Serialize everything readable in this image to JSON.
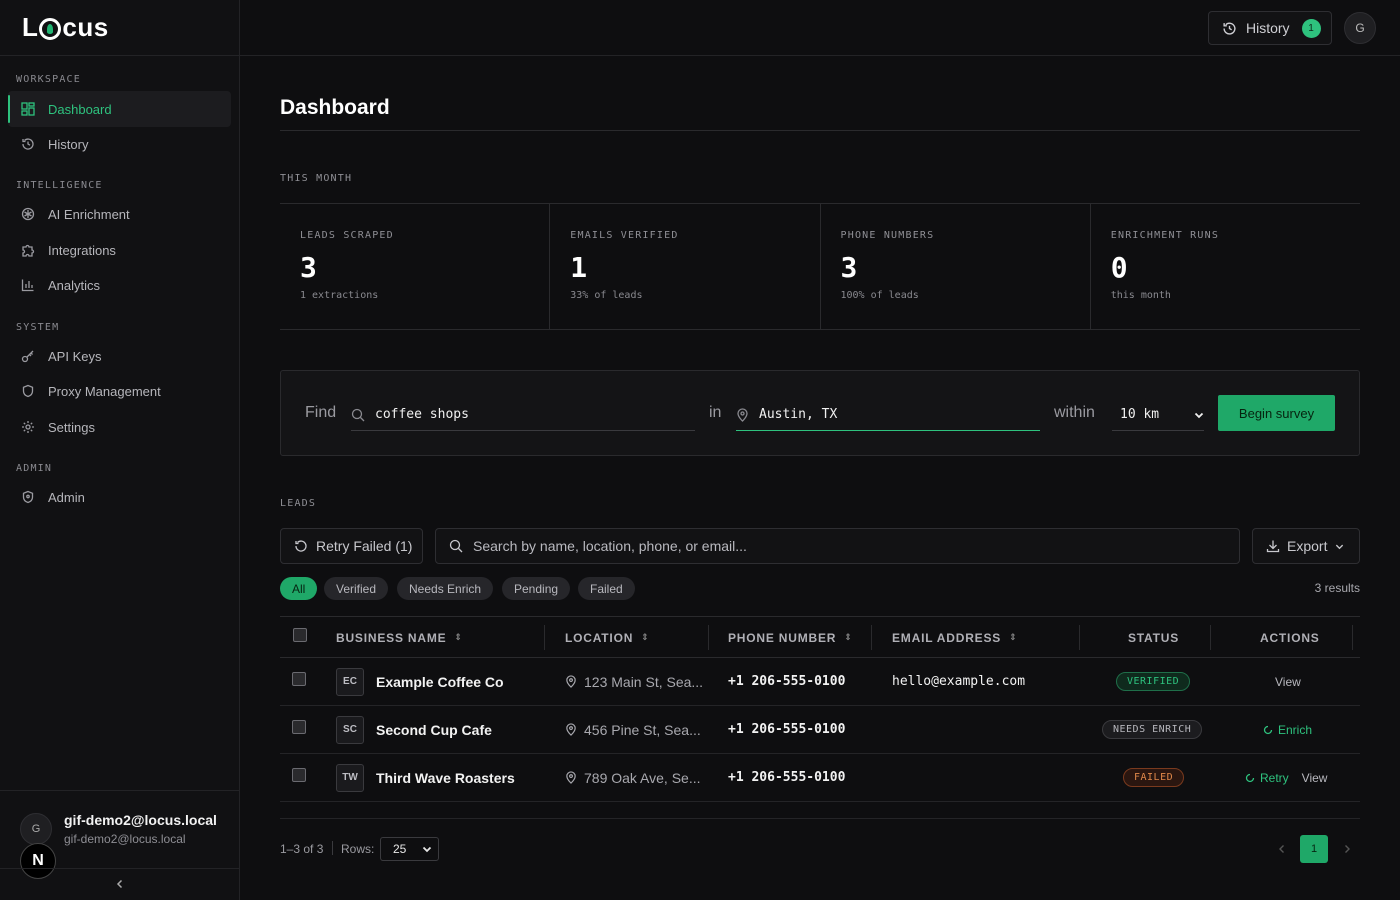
{
  "brand": {
    "logo_left": "L",
    "logo_right": "cus"
  },
  "sidebar": {
    "sections": [
      {
        "label": "WORKSPACE"
      },
      {
        "label": "INTELLIGENCE"
      },
      {
        "label": "SYSTEM"
      },
      {
        "label": "ADMIN"
      }
    ],
    "items": [
      {
        "label": "Dashboard",
        "icon": "grid-icon"
      },
      {
        "label": "History",
        "icon": "history-icon"
      },
      {
        "label": "AI Enrichment",
        "icon": "ai-icon"
      },
      {
        "label": "Integrations",
        "icon": "puzzle-icon"
      },
      {
        "label": "Analytics",
        "icon": "bar-chart-icon"
      },
      {
        "label": "API Keys",
        "icon": "key-icon"
      },
      {
        "label": "Proxy Management",
        "icon": "shield-icon"
      },
      {
        "label": "Settings",
        "icon": "gear-icon"
      },
      {
        "label": "Admin",
        "icon": "shield-check-icon"
      }
    ],
    "user": {
      "initial": "G",
      "name": "gif-demo2@locus.local",
      "email": "gif-demo2@locus.local"
    },
    "next_badge": "N"
  },
  "topbar": {
    "history_label": "History",
    "history_count": "1",
    "avatar_initial": "G"
  },
  "page": {
    "title": "Dashboard",
    "period_label": "THIS MONTH"
  },
  "stats": [
    {
      "label": "LEADS SCRAPED",
      "value": "3",
      "sub": "1 extractions"
    },
    {
      "label": "EMAILS VERIFIED",
      "value": "1",
      "sub": "33% of leads"
    },
    {
      "label": "PHONE NUMBERS",
      "value": "3",
      "sub": "100% of leads"
    },
    {
      "label": "ENRICHMENT RUNS",
      "value": "0",
      "sub": "this month"
    }
  ],
  "search": {
    "find_label": "Find",
    "query": "coffee shops",
    "in_label": "in",
    "location": "Austin, TX",
    "within_label": "within",
    "radius": "10 km",
    "button": "Begin survey"
  },
  "leads": {
    "section_label": "LEADS",
    "retry_label": "Retry Failed (1)",
    "search_placeholder": "Search by name, location, phone, or email...",
    "export_label": "Export",
    "filters": [
      "All",
      "Verified",
      "Needs Enrich",
      "Pending",
      "Failed"
    ],
    "results": "3 results",
    "columns": [
      "BUSINESS NAME",
      "LOCATION",
      "PHONE NUMBER",
      "EMAIL ADDRESS",
      "STATUS",
      "ACTIONS"
    ],
    "rows": [
      {
        "initials": "EC",
        "name": "Example Coffee Co",
        "location": "123 Main St, Sea...",
        "phone": "+1 206-555-0100",
        "email": "hello@example.com",
        "status": "VERIFIED",
        "actions": [
          "View"
        ]
      },
      {
        "initials": "SC",
        "name": "Second Cup Cafe",
        "location": "456 Pine St, Sea...",
        "phone": "+1 206-555-0100",
        "email": "",
        "status": "NEEDS ENRICH",
        "actions": [
          "Enrich"
        ]
      },
      {
        "initials": "TW",
        "name": "Third Wave Roasters",
        "location": "789 Oak Ave, Se...",
        "phone": "+1 206-555-0100",
        "email": "",
        "status": "FAILED",
        "actions": [
          "Retry",
          "View"
        ]
      }
    ]
  },
  "pagination": {
    "range": "1–3 of 3",
    "rows_label": "Rows:",
    "rows_value": "25",
    "current_page": "1"
  },
  "colors": {
    "accent": "#2ec27e",
    "background": "#0e0e10",
    "failed": "#e0884a"
  }
}
